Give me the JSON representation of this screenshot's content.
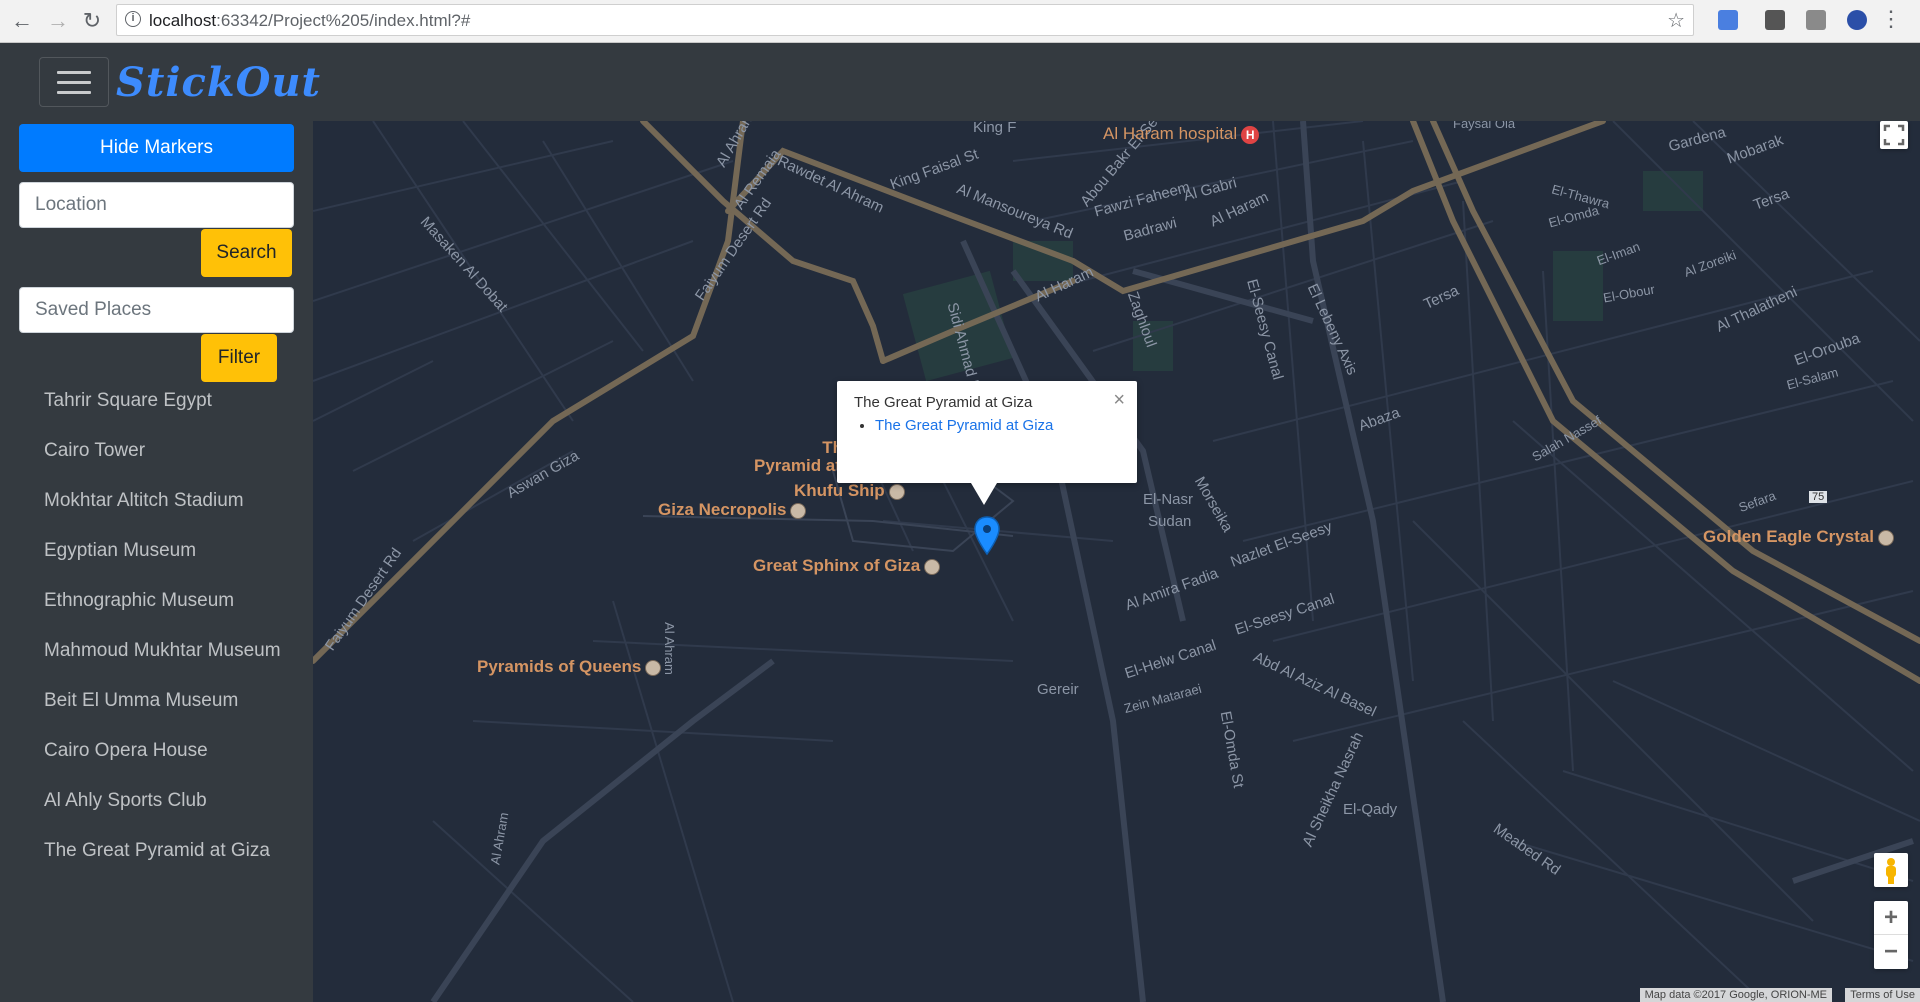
{
  "browser": {
    "url_host": "localhost",
    "url_rest": ":63342/Project%205/index.html?#"
  },
  "navbar": {
    "brand": "StickOut"
  },
  "sidebar": {
    "hide_markers_label": "Hide Markers",
    "location_placeholder": "Location",
    "search_label": "Search",
    "saved_places_placeholder": "Saved Places",
    "filter_label": "Filter",
    "places": [
      "Tahrir Square Egypt",
      "Cairo Tower",
      "Mokhtar Altitch Stadium",
      "Egyptian Museum",
      "Ethnographic Museum",
      "Mahmoud Mukhtar Museum",
      "Beit El Umma Museum",
      "Cairo Opera House",
      "Al Ahly Sports Club",
      "The Great Pyramid at Giza"
    ]
  },
  "map": {
    "infowindow": {
      "title": "The Great Pyramid at Giza",
      "close": "×",
      "link": "The Great Pyramid at Giza"
    },
    "poi": {
      "great_pyramid_line1": "The Great",
      "great_pyramid_line2": "Pyramid at Giza",
      "khufu_ship": "Khufu Ship",
      "giza_necropolis": "Giza Necropolis",
      "great_sphinx": "Great Sphinx of Giza",
      "pyramids_of_queens": "Pyramids of Queens",
      "al_haram_hospital": "Al Haram hospital",
      "golden_eagle": "Golden Eagle Crystal"
    },
    "streets": {
      "al_ahram": "Al Ahram",
      "al_remaia": "Al Remaia",
      "rawdet": "Rawdet Al Ahram",
      "king_faisal": "King Faisal St",
      "al_mansoureya": "Al Mansoureya Rd",
      "abou_bakr": "Abou Bakr El-Sedeek",
      "faiyum_desert": "Faiyum Desert Rd",
      "faiyum_desert_2": "Faiyum Desert Rd",
      "aswan_giza": "Aswan Giza",
      "masaken": "Masaken Al Dobat",
      "al_haram_1": "Al Haram",
      "al_haram_2": "Al Haram",
      "fawzi": "Fawzi Faheem",
      "badrawi": "Badrawi",
      "al_gabri": "Al Gabri",
      "zaghloul": "Zaghloul",
      "el_seesy_canal": "El-Seesy Canal",
      "el_lebeny_axis": "El Lebeny Axis",
      "abaza": "Abaza",
      "el_nasr": "El-Nasr",
      "sudan": "Sudan",
      "morseika": "Morseika",
      "nazlet": "Nazlet El-Seesy",
      "al_amira_fadia": "Al Amira Fadia",
      "el_helw_canal": "El-Helw Canal",
      "abd_al_aziz": "Abd Al Aziz Al Basel",
      "gereir": "Gereir",
      "zein": "Zein Mataraei",
      "el_omda_st": "El-Omda St",
      "al_sheikha": "Al Sheikha Nasrah",
      "el_qady": "El-Qady",
      "meabed": "Meabed Rd",
      "al_ahram_2": "Al Ahram",
      "al_ahram_3": "Al Ahram",
      "gardena": "Gardena",
      "mobarak": "Mobarak",
      "tersa": "Tersa",
      "tersa_2": "Tersa",
      "el_thawra": "El-Thawra",
      "el_omda": "El-Omda",
      "el_iman": "El-Iman",
      "al_zoreiki": "Al Zoreiki",
      "el_obour": "El-Obour",
      "al_thalatheni": "Al Thalatheni",
      "el_orouba": "El-Orouba",
      "el_salam": "El-Salam",
      "salah_nassef": "Salah Nassef",
      "sefara": "Sefara",
      "route_75": "75",
      "king_top": "King F",
      "faysal_top": "Faysal Ola",
      "sidi": "Sidi Ahmad El-Semman"
    },
    "attribution": "Map data ©2017 Google, ORION-ME",
    "terms": "Terms of Use",
    "zoom_in": "+",
    "zoom_out": "−"
  },
  "icons": {
    "back": "back-arrow-icon",
    "forward": "forward-arrow-icon",
    "reload": "reload-icon",
    "menu": "hamburger-menu-icon",
    "marker": "map-pin-icon",
    "fullscreen": "fullscreen-icon",
    "pegman": "street-view-pegman-icon"
  },
  "colors": {
    "primary": "#007bff",
    "warning": "#ffc107",
    "navbar": "#343a40",
    "map_bg": "#232c3b",
    "poi_text": "#d59563",
    "marker": "#1a8cff"
  }
}
